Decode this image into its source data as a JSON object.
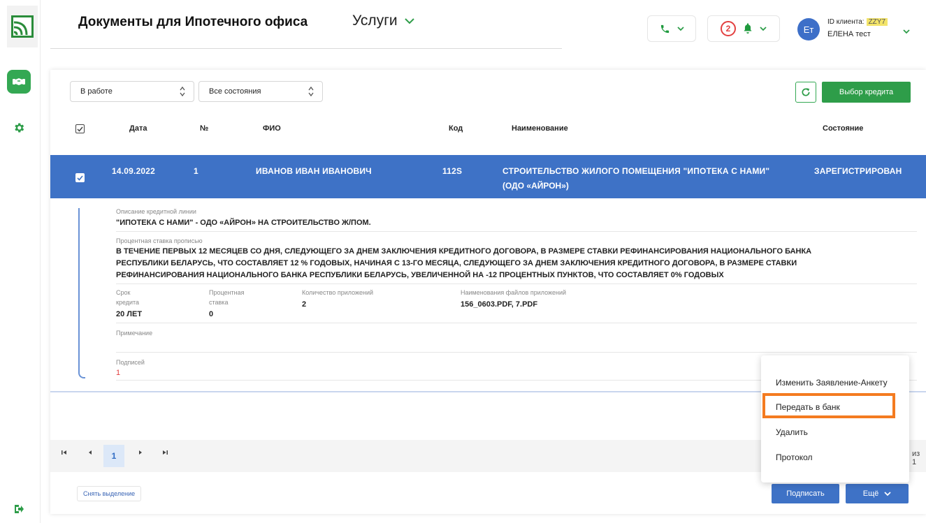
{
  "header": {
    "title": "Документы для Ипотечного офиса",
    "services_label": "Услуги",
    "notifications_count": "2",
    "client_id_label": "ID клиента:",
    "client_id_value": "ZZY7",
    "avatar_initials": "Ет",
    "user_name": "ЕЛЕНА тест"
  },
  "toolbar": {
    "status_select": "В работе",
    "state_select": "Все состояния",
    "choose_credit_label": "Выбор кредита"
  },
  "table": {
    "columns": [
      "Дата",
      "№",
      "ФИО",
      "Код",
      "Наименование",
      "Состояние"
    ],
    "row": {
      "date": "14.09.2022",
      "number": "1",
      "fio": "ИВАНОВ ИВАН ИВАНОВИЧ",
      "code": "112S",
      "name_line1": "СТРОИТЕЛЬСТВО ЖИЛОГО ПОМЕЩЕНИЯ \"ИПОТЕКА С НАМИ\"",
      "name_line2": "(ОДО «АЙРОН»)",
      "state": "ЗАРЕГИСТРИРОВАН"
    }
  },
  "detail": {
    "credit_line_label": "Описание кредитной линии",
    "credit_line_value": "\"ИПОТЕКА С НАМИ\" - ОДО «АЙРОН» НА СТРОИТЕЛЬСТВО Ж/ПОМ.",
    "rate_text_label": "Процентная ставка прописью",
    "rate_text_line1": "В ТЕЧЕНИЕ ПЕРВЫХ 12 МЕСЯЦЕВ СО ДНЯ, СЛЕДУЮЩЕГО ЗА ДНЕМ ЗАКЛЮЧЕНИЯ КРЕДИТНОГО ДОГОВОРА, В РАЗМЕРЕ СТАВКИ РЕФИНАНСИРОВАНИЯ НАЦИОНАЛЬНОГО БАНКА",
    "rate_text_line2": "РЕСПУБЛИКИ БЕЛАРУСЬ, ЧТО СОСТАВЛЯЕТ 12 % ГОДОВЫХ, НАЧИНАЯ С 13-ГО МЕСЯЦА, СЛЕДУЮЩЕГО ЗА ДНЕМ ЗАКЛЮЧЕНИЯ КРЕДИТНОГО ДОГОВОРА, В РАЗМЕРЕ СТАВКИ",
    "rate_text_line3": "РЕФИНАНСИРОВАНИЯ НАЦИОНАЛЬНОГО БАНКА РЕСПУБЛИКИ БЕЛАРУСЬ, УВЕЛИЧЕННОЙ НА -12 ПРОЦЕНТНЫХ ПУНКТОВ, ЧТО СОСТАВЛЯЕТ 0% ГОДОВЫХ",
    "term_label_1": "Срок",
    "term_label_2": "кредита",
    "term_value": "20 ЛЕТ",
    "rate_label_1": "Процентная",
    "rate_label_2": "ставка",
    "rate_value": "0",
    "attach_count_label": "Количество приложений",
    "attach_count_value": "2",
    "attach_names_label": "Наименования файлов приложений",
    "attach_names_value": "156_0603.PDF, 7.PDF",
    "note_label": "Примечание",
    "signatures_label": "Подписей",
    "signatures_value": "1"
  },
  "pagination": {
    "current_page": "1",
    "right_text": "из 1"
  },
  "footer": {
    "deselect_label": "Снять выделение",
    "sign_label": "Подписать",
    "more_label": "Ещё"
  },
  "menu": {
    "items": [
      "Изменить Заявление-Анкету",
      "Передать в банк",
      "Удалить",
      "Протокол"
    ]
  },
  "colors": {
    "brand_green": "#2e9d49",
    "selection_blue": "#3e72c6",
    "highlight_orange": "#f47b20",
    "alert_red": "#e34040"
  }
}
